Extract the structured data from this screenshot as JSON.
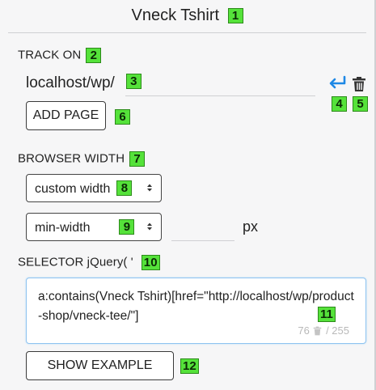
{
  "header": {
    "title": "Vneck Tshirt",
    "badge": "1"
  },
  "track_on": {
    "label": "TRACK ON",
    "badge": "2",
    "url_value": "localhost/wp/",
    "url_badge": "3",
    "return_badge": "4",
    "delete_badge": "5",
    "add_page_label": "ADD PAGE",
    "add_page_badge": "6"
  },
  "browser_width": {
    "label": "BROWSER WIDTH",
    "badge": "7",
    "width_select": {
      "selected": "custom width",
      "badge": "8"
    },
    "minmax_select": {
      "selected": "min-width",
      "badge": "9"
    },
    "px_value": "",
    "unit": "px"
  },
  "selector": {
    "label": "SELECTOR jQuery( '",
    "badge": "10",
    "value": "a:contains(Vneck Tshirt)[href=\"http://localhost/wp/product-shop/vneck-tee/\"]",
    "value_badge": "11",
    "count": "76",
    "max": "/ 255"
  },
  "show_example": {
    "label": "SHOW EXAMPLE",
    "badge": "12"
  },
  "colors": {
    "accent_blue": "#1e88e5",
    "badge_green": "#55e23a",
    "focus_border": "#8ec3f0"
  },
  "icons": [
    "return-icon",
    "trash-icon",
    "select-arrows-icon",
    "mini-trash-icon"
  ]
}
